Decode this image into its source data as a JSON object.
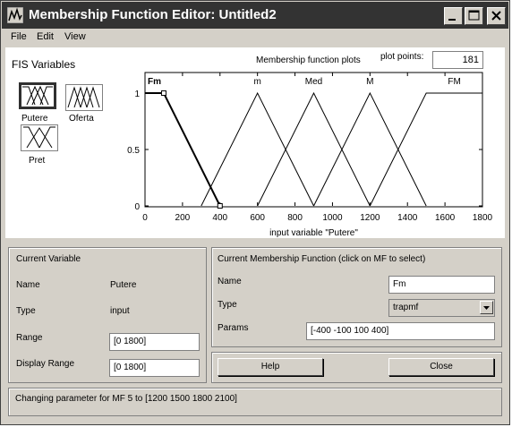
{
  "window": {
    "title": "Membership Function Editor: Untitled2"
  },
  "menu": {
    "file": "File",
    "edit": "Edit",
    "view": "View"
  },
  "fis": {
    "label": "FIS Variables",
    "variables": [
      {
        "name": "Putere",
        "selected": true
      },
      {
        "name": "Oferta",
        "selected": false
      },
      {
        "name": "Pret",
        "selected": false
      }
    ]
  },
  "plot": {
    "title": "Membership function plots",
    "plot_points_label": "plot points:",
    "plot_points_value": "181",
    "xlabel": "input variable \"Putere\""
  },
  "chart_data": {
    "type": "line",
    "xlim": [
      0,
      1800
    ],
    "ylim": [
      0,
      1
    ],
    "xticks": [
      "0",
      "200",
      "400",
      "600",
      "800",
      "1000",
      "1200",
      "1400",
      "1600",
      "1800"
    ],
    "xtick_values": [
      0,
      200,
      400,
      600,
      800,
      1000,
      1200,
      1400,
      1600,
      1800
    ],
    "yticks": [
      "0",
      "0.5",
      "1"
    ],
    "ytick_values": [
      0,
      0.5,
      1
    ],
    "series": [
      {
        "name": "Fm",
        "type": "trapmf",
        "params": [
          -400,
          -100,
          100,
          400
        ],
        "selected": true,
        "label_x": 50
      },
      {
        "name": "m",
        "type": "trimf",
        "params": [
          300,
          600,
          900
        ],
        "selected": false,
        "label_x": 600
      },
      {
        "name": "Med",
        "type": "trimf",
        "params": [
          600,
          900,
          1200
        ],
        "selected": false,
        "label_x": 900
      },
      {
        "name": "M",
        "type": "trimf",
        "params": [
          900,
          1200,
          1500
        ],
        "selected": false,
        "label_x": 1200
      },
      {
        "name": "FM",
        "type": "trapmf",
        "params": [
          1200,
          1500,
          1800,
          2100
        ],
        "selected": false,
        "label_x": 1650
      }
    ]
  },
  "current_variable": {
    "heading": "Current Variable",
    "name_label": "Name",
    "name_value": "Putere",
    "type_label": "Type",
    "type_value": "input",
    "range_label": "Range",
    "range_value": "[0 1800]",
    "display_range_label": "Display Range",
    "display_range_value": "[0 1800]"
  },
  "current_mf": {
    "heading": "Current Membership Function (click on MF to select)",
    "name_label": "Name",
    "name_value": "Fm",
    "type_label": "Type",
    "type_value": "trapmf",
    "params_label": "Params",
    "params_value": "[-400 -100 100 400]"
  },
  "buttons": {
    "help": "Help",
    "close": "Close"
  },
  "status": {
    "text": "Changing parameter for MF 5 to  [1200 1500 1800 2100]"
  }
}
